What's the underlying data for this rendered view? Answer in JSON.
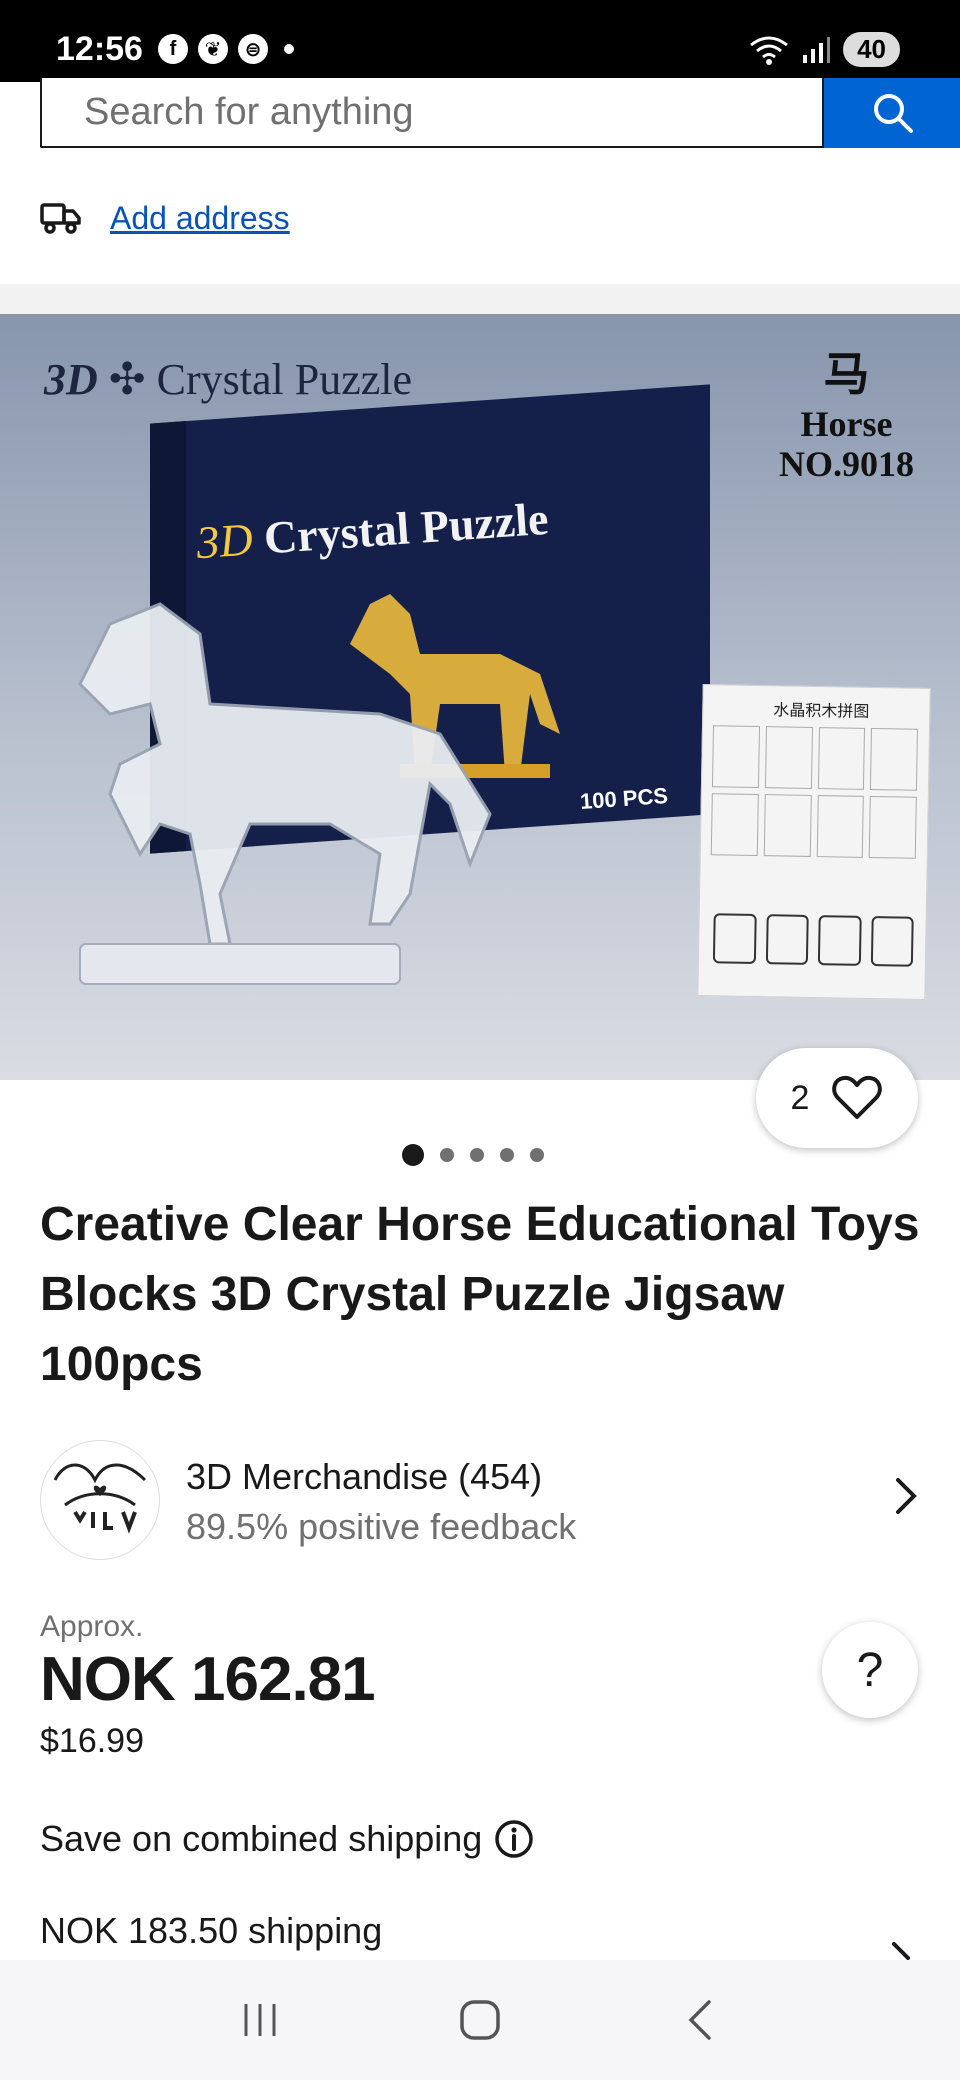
{
  "status_bar": {
    "time": "12:56",
    "app_icons": [
      "facebook-icon",
      "leaf-icon",
      "app-icon"
    ],
    "battery": "40"
  },
  "search": {
    "placeholder": "Search for anything"
  },
  "address": {
    "link_label": "Add address"
  },
  "product_image": {
    "caption_left_prefix": "3D",
    "caption_left": "Crystal Puzzle",
    "caption_right_glyph": "马",
    "caption_right_name": "Horse",
    "caption_right_model": "NO.9018",
    "box_title_prefix": "3D",
    "box_title": "Crystal Puzzle",
    "box_pieces": "100 PCS",
    "leaflet_title": "水晶积木拼图"
  },
  "favorites": {
    "count": "2"
  },
  "carousel": {
    "total": 5,
    "active_index": 0
  },
  "product": {
    "title": "Creative Clear Horse Educational Toys Blocks 3D Crystal Puzzle Jigsaw 100pcs"
  },
  "seller": {
    "name": "3D Merchandise (454)",
    "feedback": "89.5% positive feedback"
  },
  "price": {
    "approx_label": "Approx.",
    "local": "NOK 162.81",
    "usd": "$16.99"
  },
  "help": {
    "label": "?"
  },
  "shipping": {
    "combined_label": "Save on combined shipping",
    "cost": "NOK 183.50 shipping"
  },
  "colors": {
    "accent": "#0064d2",
    "link": "#0654ba",
    "text": "#191919",
    "muted": "#707070"
  }
}
